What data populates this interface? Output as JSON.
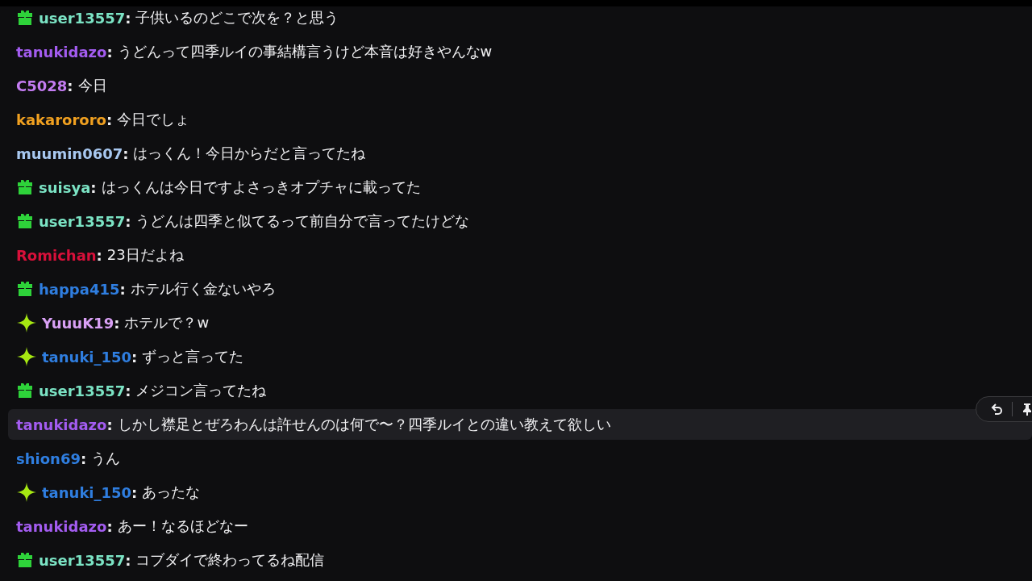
{
  "messages": [
    {
      "kind": "gift",
      "user": "user13557",
      "sep": ":",
      "color": "#7be3c4",
      "text": "子供いるのどこで次を？と思う",
      "highlighted": false
    },
    {
      "kind": "plain",
      "user": "tanukidazo",
      "sep": ":",
      "color": "#a35cf0",
      "text": "うどんって四季ルイの事結構言うけど本音は好きやんなw",
      "highlighted": false
    },
    {
      "kind": "plain",
      "user": "C5028",
      "sep": ":",
      "color": "#c47cf2",
      "text": "今日",
      "highlighted": false
    },
    {
      "kind": "plain",
      "user": "kakarororo",
      "sep": ":",
      "color": "#f0a020",
      "text": "今日でしょ",
      "highlighted": false
    },
    {
      "kind": "plain",
      "user": "muumin0607",
      "sep": ":",
      "color": "#a8c8f0",
      "text": "はっくん！今日からだと言ってたね",
      "highlighted": false
    },
    {
      "kind": "gift",
      "user": "suisya",
      "sep": ":",
      "color": "#7be3c4",
      "text": "はっくんは今日ですよさっきオプチャに載ってた",
      "highlighted": false
    },
    {
      "kind": "gift",
      "user": "user13557",
      "sep": ":",
      "color": "#7be3c4",
      "text": "うどんは四季と似てるって前自分で言ってたけどな",
      "highlighted": false
    },
    {
      "kind": "plain",
      "user": "Romichan",
      "sep": ":",
      "color": "#d8103a",
      "text": "23日だよね",
      "highlighted": false
    },
    {
      "kind": "gift",
      "user": "happa415",
      "sep": ":",
      "color": "#2f7ee0",
      "text": "ホテル行く金ないやろ",
      "highlighted": false
    },
    {
      "kind": "sparkle",
      "user": "YuuuK19",
      "sep": ":",
      "color": "#d9a0f5",
      "text": "ホテルで？w",
      "highlighted": false
    },
    {
      "kind": "sparkle",
      "user": "tanuki_150",
      "sep": ":",
      "color": "#2f7ee0",
      "text": "ずっと言ってた",
      "highlighted": false
    },
    {
      "kind": "gift",
      "user": "user13557",
      "sep": ":",
      "color": "#7be3c4",
      "text": "メジコン言ってたね",
      "highlighted": false
    },
    {
      "kind": "plain",
      "user": "tanukidazo",
      "sep": ":",
      "color": "#a35cf0",
      "text": "しかし襟足とぜろわんは許せんのは何で〜？四季ルイとの違い教えて欲しい",
      "highlighted": true
    },
    {
      "kind": "plain",
      "user": "shion69",
      "sep": ":",
      "color": "#2f7ee0",
      "text": "うん",
      "highlighted": false
    },
    {
      "kind": "sparkle",
      "user": "tanuki_150",
      "sep": ":",
      "color": "#2f7ee0",
      "text": "あったな",
      "highlighted": false
    },
    {
      "kind": "plain",
      "user": "tanukidazo",
      "sep": ":",
      "color": "#a35cf0",
      "text": "あー！なるほどなー",
      "highlighted": false
    },
    {
      "kind": "gift",
      "user": "user13557",
      "sep": ":",
      "color": "#7be3c4",
      "text": "コブダイで終わってるね配信",
      "highlighted": false
    }
  ]
}
